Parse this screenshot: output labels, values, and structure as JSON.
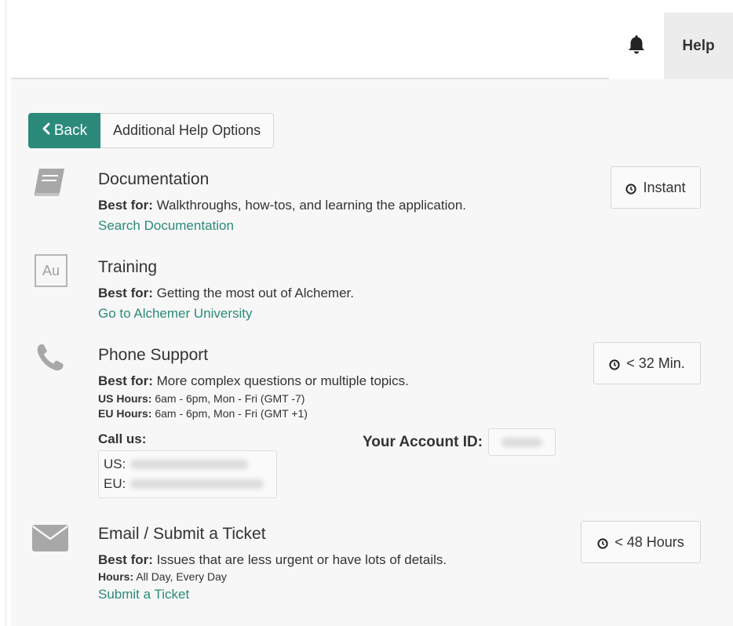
{
  "header": {
    "help_tab": "Help",
    "bell_icon": "bell-icon"
  },
  "nav": {
    "back_label": "Back",
    "back_icon": "chevron-left-icon",
    "title": "Additional Help Options"
  },
  "sections": [
    {
      "icon": "book-icon",
      "title": "Documentation",
      "best_for_label": "Best for:",
      "best_for_text": " Walkthroughs, how-tos, and learning the application.",
      "link": "Search Documentation",
      "badge": "Instant"
    },
    {
      "icon": "alchemer-university-logo",
      "icon_text": "Au",
      "title": "Training",
      "best_for_label": "Best for:",
      "best_for_text": " Getting the most out of Alchemer.",
      "link": "Go to Alchemer University"
    },
    {
      "icon": "phone-icon",
      "title": "Phone Support",
      "best_for_label": "Best for:",
      "best_for_text": " More complex questions or multiple topics.",
      "us_hours_label": "US Hours:",
      "us_hours": " 6am - 6pm, Mon - Fri (GMT -7)",
      "eu_hours_label": "EU Hours:",
      "eu_hours": " 6am - 6pm, Mon - Fri (GMT +1)",
      "call_us_label": "Call us:",
      "us_label": "US:",
      "eu_label": "EU:",
      "account_id_label": "Your Account ID:",
      "badge": "< 32 Min."
    },
    {
      "icon": "envelope-icon",
      "title": "Email / Submit a Ticket",
      "best_for_label": "Best for:",
      "best_for_text": " Issues that are less urgent or have lots of details.",
      "hours_label": "Hours:",
      "hours": " All Day, Every Day",
      "link": "Submit a Ticket",
      "badge": "< 48 Hours"
    }
  ],
  "colors": {
    "accent": "#2b8a7a",
    "icon_gray": "#a8a8a8",
    "panel_bg": "#f7f7f7"
  }
}
